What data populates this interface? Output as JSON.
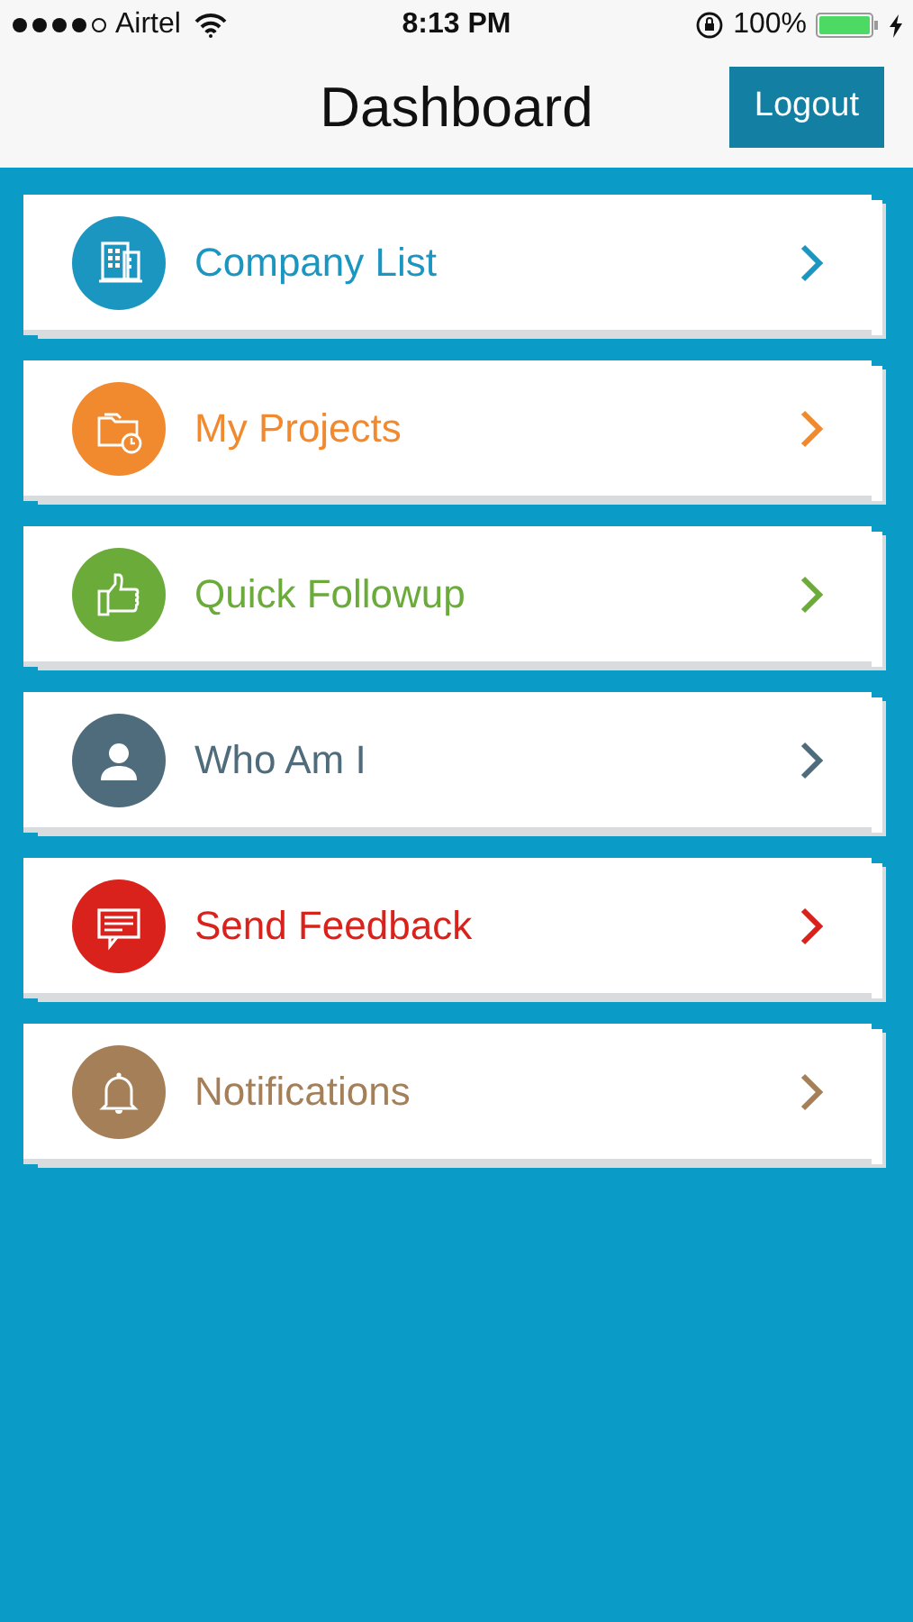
{
  "status_bar": {
    "carrier": "Airtel",
    "time": "8:13 PM",
    "battery": "100%"
  },
  "header": {
    "title": "Dashboard",
    "logout_button": "Logout"
  },
  "menu": [
    {
      "label": "Company List",
      "color": "#1b96c1"
    },
    {
      "label": "My Projects",
      "color": "#f18a2f"
    },
    {
      "label": "Quick Followup",
      "color": "#6aab3a"
    },
    {
      "label": "Who Am I",
      "color": "#4f6c7c"
    },
    {
      "label": "Send Feedback",
      "color": "#d8221b"
    },
    {
      "label": "Notifications",
      "color": "#a57f58"
    }
  ]
}
